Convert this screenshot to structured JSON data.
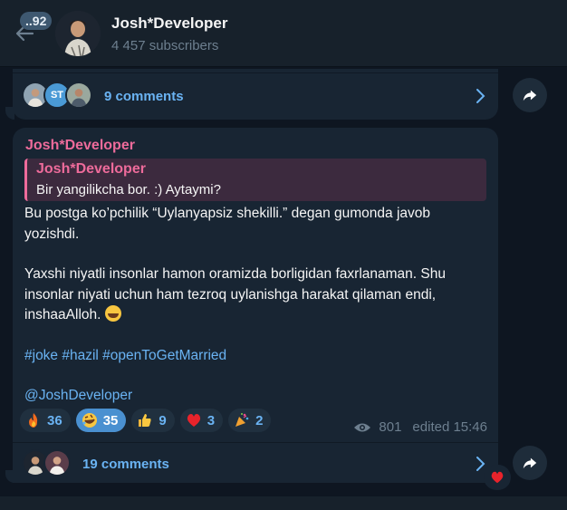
{
  "header": {
    "unread_count": "..92",
    "channel_name": "Josh*Developer",
    "subscribers": "4 457 subscribers"
  },
  "post_prev": {
    "comments_label": "9 comments",
    "avatars": [
      {
        "kind": "photo",
        "initials": ""
      },
      {
        "kind": "initials",
        "initials": "ST"
      },
      {
        "kind": "photo",
        "initials": ""
      }
    ]
  },
  "post": {
    "author": "Josh*Developer",
    "reply": {
      "name": "Josh*Developer",
      "text": "Bir yangilikcha bor. :)  Aytaymi?"
    },
    "paragraph1": "Bu postga ko’pchilik “Uylanyapsiz shekilli.” degan gumonda javob yozishdi.",
    "paragraph2": "Yaxshi niyatli insonlar hamon oramizda borligidan faxrlanaman. Shu insonlar niyati uchun ham tezroq uylanishga harakat qilaman endi, inshaaAlloh.",
    "hashtags": "#joke #hazil #openToGetMarried",
    "signature": "@JoshDeveloper",
    "reactions": [
      {
        "icon": "fire-icon",
        "count": "36",
        "active": false
      },
      {
        "icon": "rofl-icon",
        "count": "35",
        "active": true
      },
      {
        "icon": "thumbs-up-icon",
        "count": "9",
        "active": false
      },
      {
        "icon": "heart-icon",
        "count": "3",
        "active": false
      },
      {
        "icon": "party-popper-icon",
        "count": "2",
        "active": false
      }
    ],
    "views": "801",
    "edited": "edited 15:46",
    "comments_label": "19 comments"
  },
  "colors": {
    "background": "#0e1621",
    "bubble": "#182533",
    "accent": "#6ab3f3",
    "author": "#ee6b9b"
  }
}
